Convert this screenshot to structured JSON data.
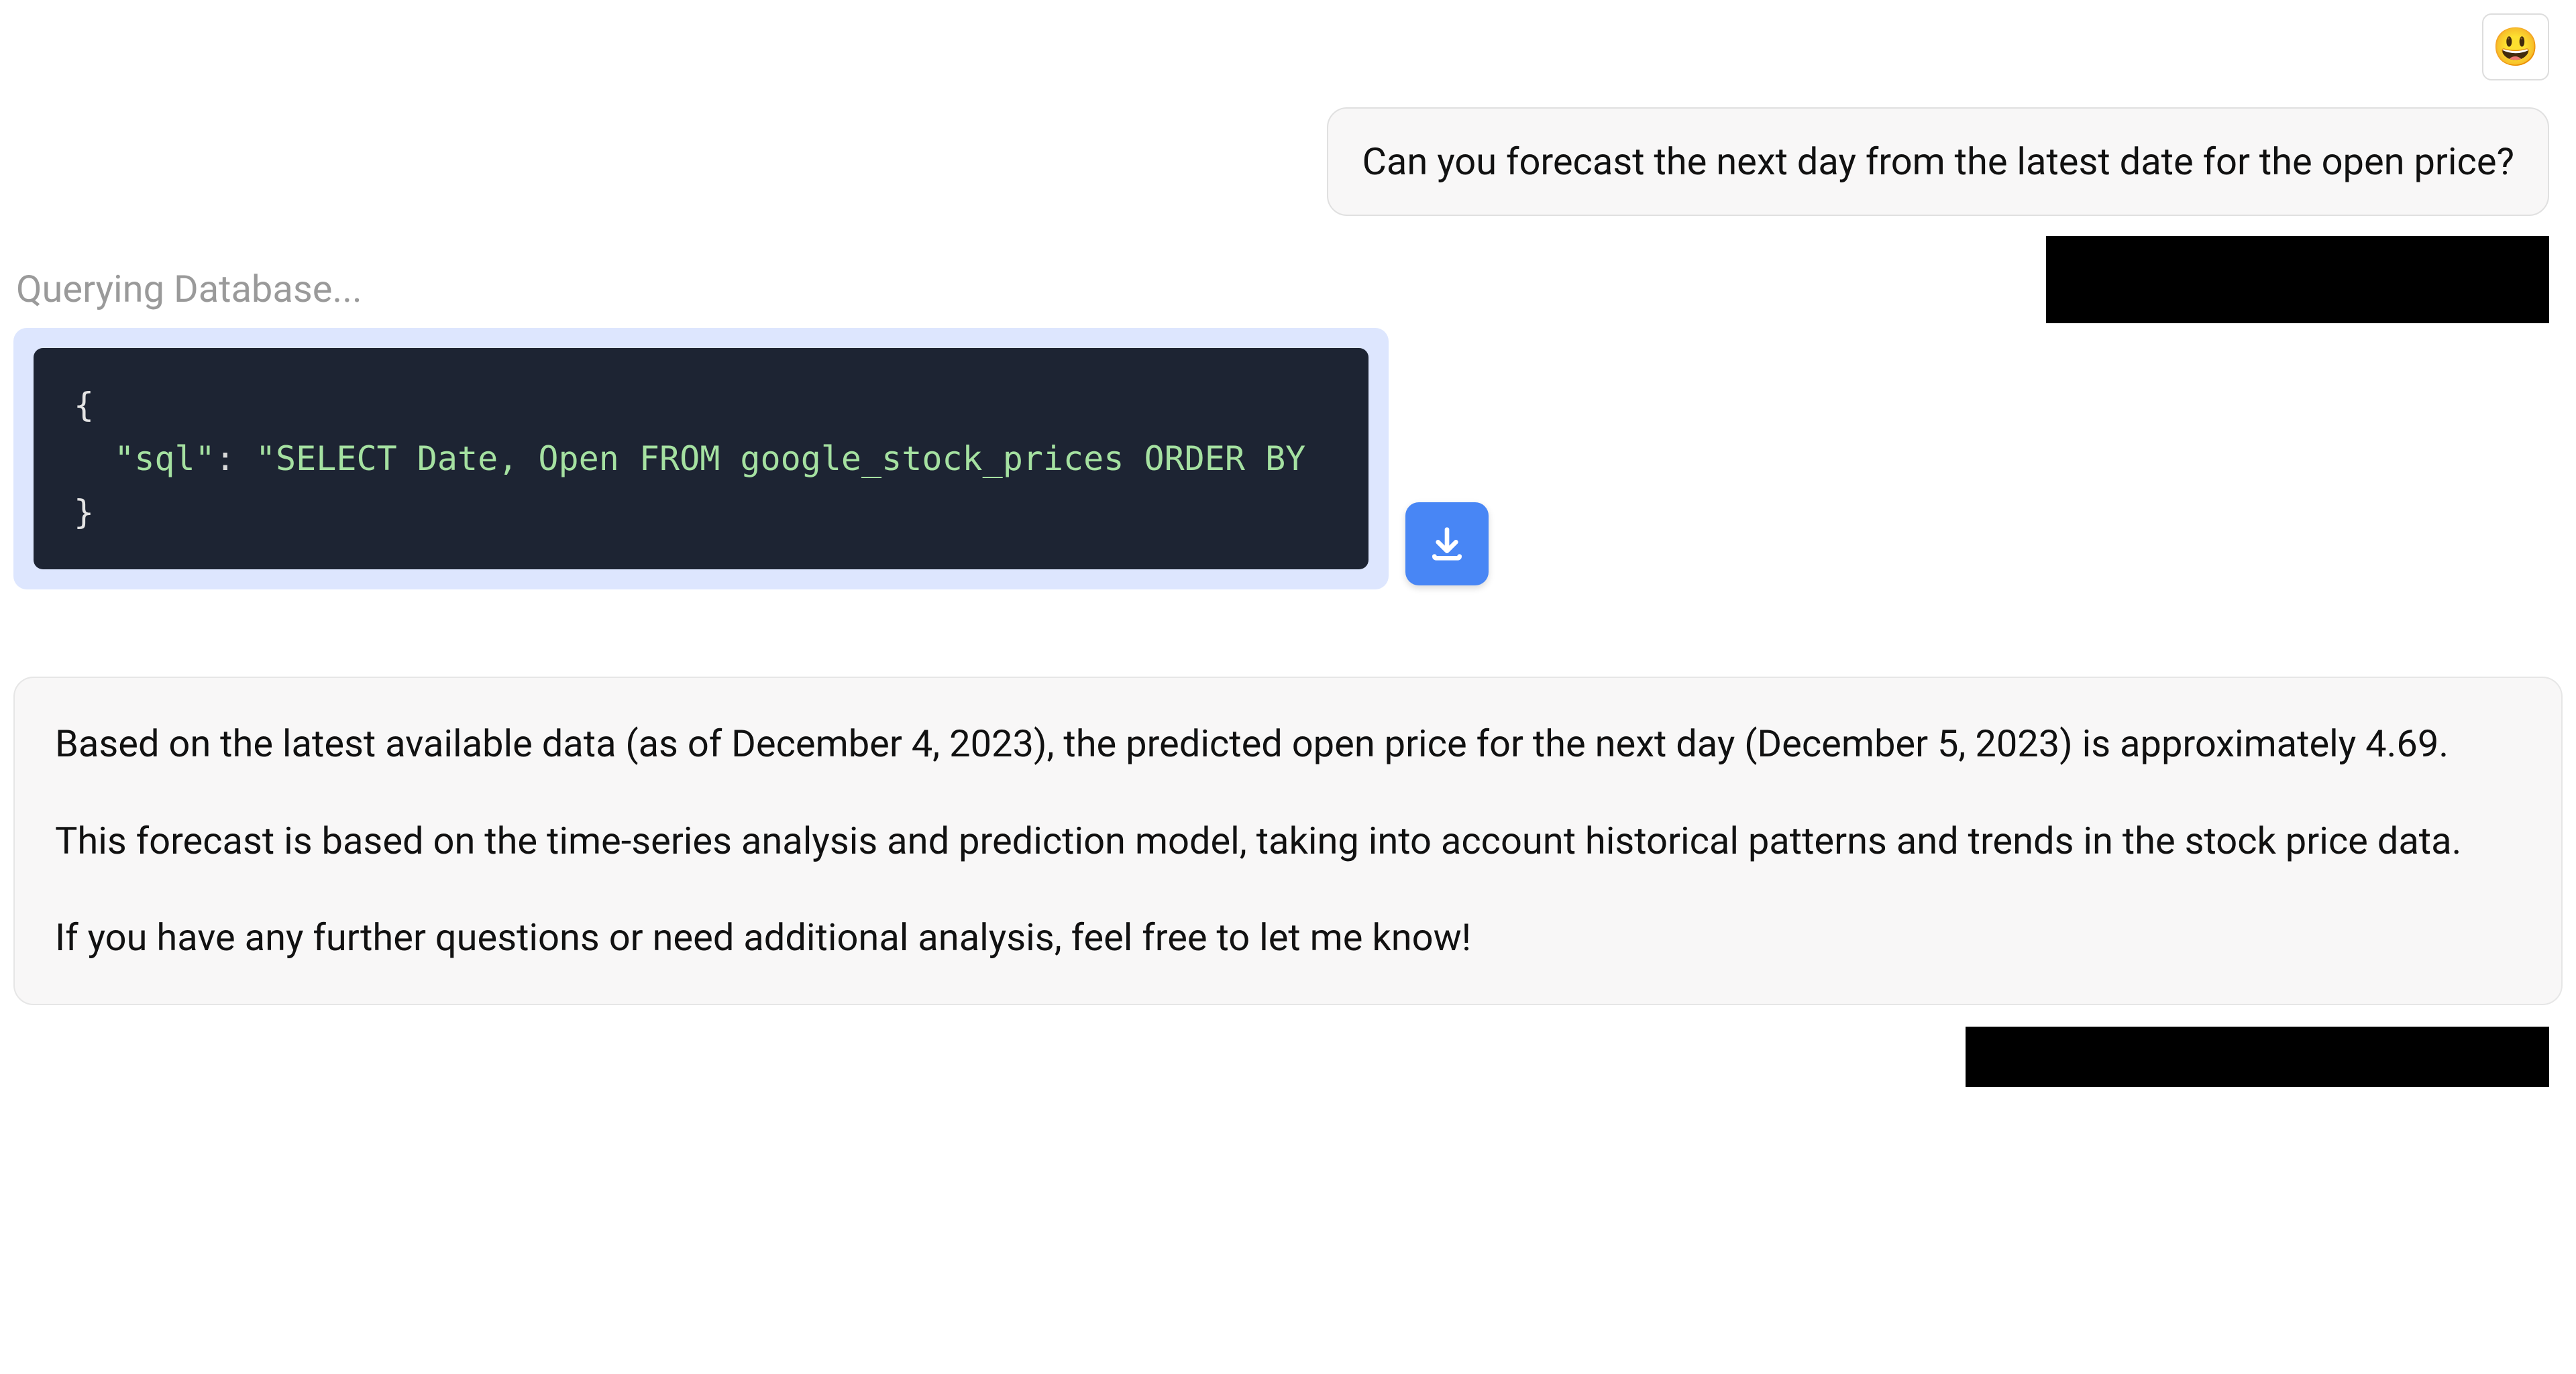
{
  "avatar_emoji": "😃",
  "user_message": "Can you forecast the next day from the latest date for the open price?",
  "status_text": "Querying Database...",
  "code": {
    "open_brace": "{",
    "key": "\"sql\"",
    "colon": ": ",
    "value": "\"SELECT Date, Open FROM google_stock_prices ORDER BY",
    "close_brace": "}"
  },
  "assistant_message": {
    "p1": "Based on the latest available data (as of December 4, 2023), the predicted open price for the next day (December 5, 2023) is approximately 4.69.",
    "p2": "This forecast is based on the time-series analysis and prediction model, taking into account historical patterns and trends in the stock price data.",
    "p3": "If you have any further questions or need additional analysis, feel free to let me know!"
  }
}
